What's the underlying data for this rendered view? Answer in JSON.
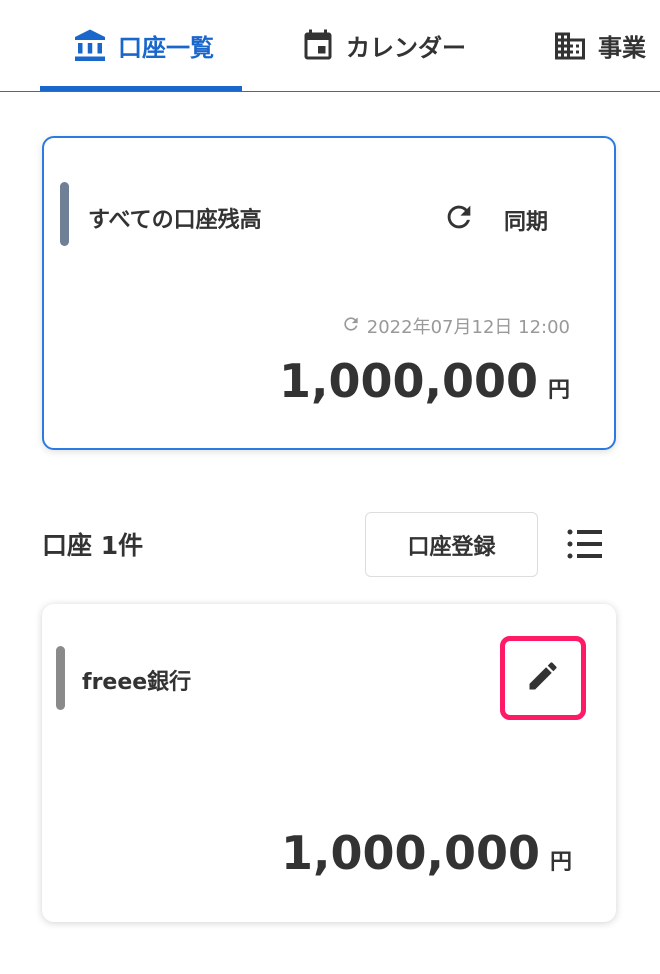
{
  "tabs": [
    {
      "label": "口座一覧",
      "icon": "bank-icon",
      "active": true
    },
    {
      "label": "カレンダー",
      "icon": "calendar-icon",
      "active": false
    },
    {
      "label": "事業",
      "icon": "building-icon",
      "active": false
    }
  ],
  "summary": {
    "title": "すべての口座残高",
    "sync_label": "同期",
    "updated_at": "2022年07月12日 12:00",
    "amount": "1,000,000",
    "unit": "円"
  },
  "accounts_section": {
    "title": "口座 1件",
    "register_label": "口座登録",
    "list_icon": "list-icon"
  },
  "accounts": [
    {
      "name": "freee銀行",
      "amount": "1,000,000",
      "unit": "円"
    }
  ],
  "colors": {
    "accent": "#1a67cc",
    "summary_border": "#2a7ae2",
    "summary_bar": "#6e7f96",
    "account_bar": "#8a8a8a",
    "highlight": "#ff1a66",
    "text": "#333333",
    "muted": "#999999"
  }
}
